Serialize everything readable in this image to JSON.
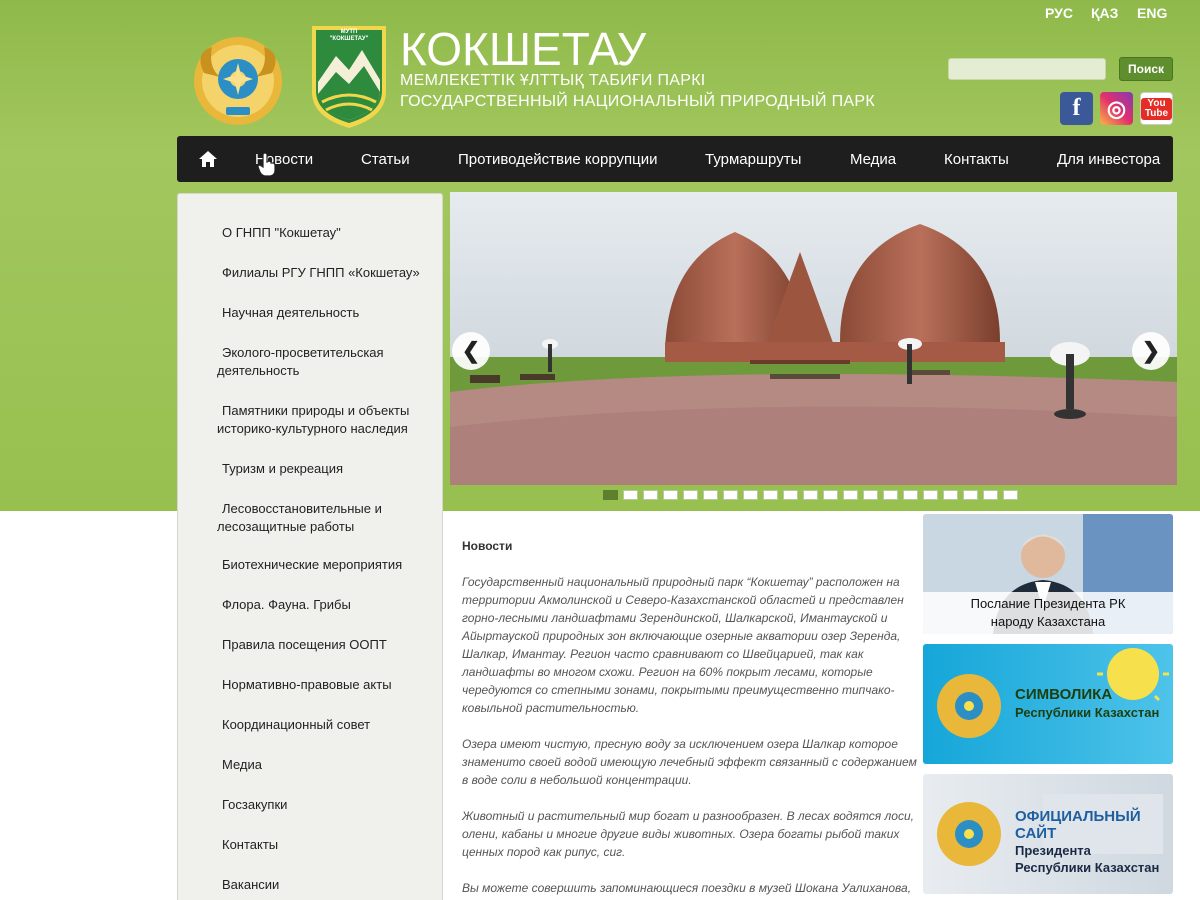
{
  "languages": [
    "РУС",
    "ҚАЗ",
    "ENG"
  ],
  "brand": {
    "title": "КОКШЕТАУ",
    "subtitle_kz": "МЕМЛЕКЕТТІК ҰЛТТЫҚ ТАБИҒИ ПАРКІ",
    "subtitle_ru": "ГОСУДАРСТВЕННЫЙ НАЦИОНАЛЬНЫЙ ПРИРОДНЫЙ ПАРК",
    "logo_top": "МУТП",
    "logo_name": "\"КОКШЕТАУ\""
  },
  "search": {
    "button": "Поиск",
    "value": ""
  },
  "social": [
    {
      "name": "facebook",
      "label": "f"
    },
    {
      "name": "instagram",
      "label": "◎"
    },
    {
      "name": "youtube",
      "label": "You Tube"
    }
  ],
  "nav": [
    "Новости",
    "Статьи",
    "Противодействие коррупции",
    "Турмаршруты",
    "Медиа",
    "Контакты",
    "Для инвестора"
  ],
  "sidebar": [
    "О ГНПП \"Кокшетау\"",
    "Филиалы РГУ ГНПП «Кокшетау»",
    "Научная деятельность",
    "Эколого-просветительская деятельность",
    "Памятники природы и объекты историко-культурного наследия",
    "Туризм и рекреация",
    "Лесовосстановительные и лесозащитные работы",
    "Биотехнические мероприятия",
    "Флора. Фауна. Грибы",
    "Правила посещения ООПТ",
    "Нормативно-правовые акты",
    "Координационный совет",
    "Медиа",
    "Госзакупки",
    "Контакты",
    "Вакансии"
  ],
  "slider": {
    "slides_count": 21,
    "active_slide": 1
  },
  "content": {
    "title": "Новости",
    "paragraphs": [
      "Государственный национальный природный парк “Кокшетау” расположен на территории Акмолинской и Северо-Казахстанской областей и представлен горно-лесными ландшафтами Зерендинской, Шалкарской, Имантауской и Айыртауской природных зон включающие озерные акватории озер Зеренда, Шалкар, Имантау. Регион часто сравнивают со Швейцарией, так как ландшафты во многом схожи. Регион на 60% покрыт лесами, которые чередуются со степными зонами, покрытыми преимущественно типчако-ковыльной растительностью.",
      "Озера имеют чистую, пресную воду за исключением озера Шалкар которое знаменито своей водой имеющую лечебный эффект связанный с содержанием в воде соли в небольшой концентрации.",
      "Животный и растительный мир богат и разнообразен. В лесах водятся лоси, олени, кабаны и многие другие виды животных. Озера богаты рыбой таких ценных пород как рипус, сиг.",
      "Вы можете совершить запоминающиеся поездки в музей Шокана Уалиханова,"
    ]
  },
  "banners": {
    "president_message": [
      "Послание Президента РК",
      "народу Казахстана"
    ],
    "symbols": [
      "СИМВОЛИКА",
      "Республики Казахстан"
    ],
    "official_site": [
      "ОФИЦИАЛЬНЫЙ САЙТ",
      "Президента",
      "Республики Казахстан"
    ]
  },
  "colors": {
    "header_green": "#97c04f",
    "nav_bg": "#1e1e1e",
    "button_green": "#5e8e2d"
  }
}
